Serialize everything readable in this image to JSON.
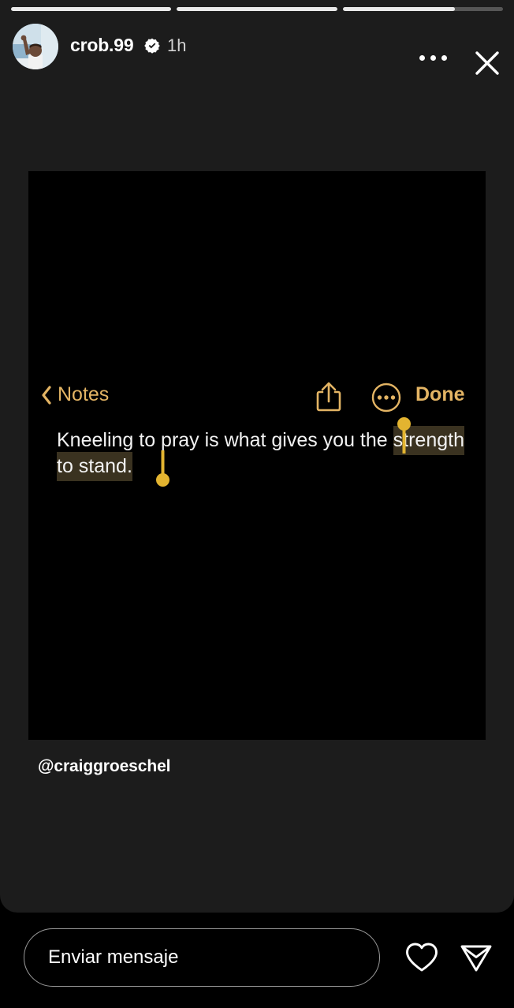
{
  "app": {
    "name": "Instagram Stories",
    "background_color": "#000000",
    "panel_color": "#1c1c1c"
  },
  "story": {
    "progress": {
      "segments": 3,
      "values": [
        100,
        100,
        70
      ],
      "active_index": 2,
      "filled_color": "#e9e9e9",
      "track_color": "#565656"
    },
    "header": {
      "avatar_name": "user-avatar",
      "username": "crob.99",
      "verified": true,
      "verified_icon": "verified-badge-icon",
      "timestamp": "1h",
      "more_icon": "more-options-icon",
      "close_icon": "close-icon"
    },
    "caption": "@craiggroeschel"
  },
  "note_card": {
    "background_color": "#000000",
    "toolbar": {
      "back_icon": "chevron-left-icon",
      "back_label": "Notes",
      "share_icon": "share-icon",
      "ellipsis_icon": "more-circle-icon",
      "done_label": "Done",
      "accent_color": "#e3b464"
    },
    "text": {
      "line1_before": "Kneeling to pray is what gives you the ",
      "line1_selected": "strength",
      "line2_selected": "to stand.",
      "full_text": "Kneeling to pray is what gives you the strength to stand.",
      "selection_highlight_color": "#3a3220",
      "selection_handle_color": "#e3b430",
      "text_color": "#f2f2f2",
      "start_handle_name": "selection-handle-start",
      "end_handle_name": "selection-handle-end"
    }
  },
  "bottom_bar": {
    "message_placeholder": "Enviar mensaje",
    "like_icon": "heart-icon",
    "send_icon": "send-icon"
  }
}
